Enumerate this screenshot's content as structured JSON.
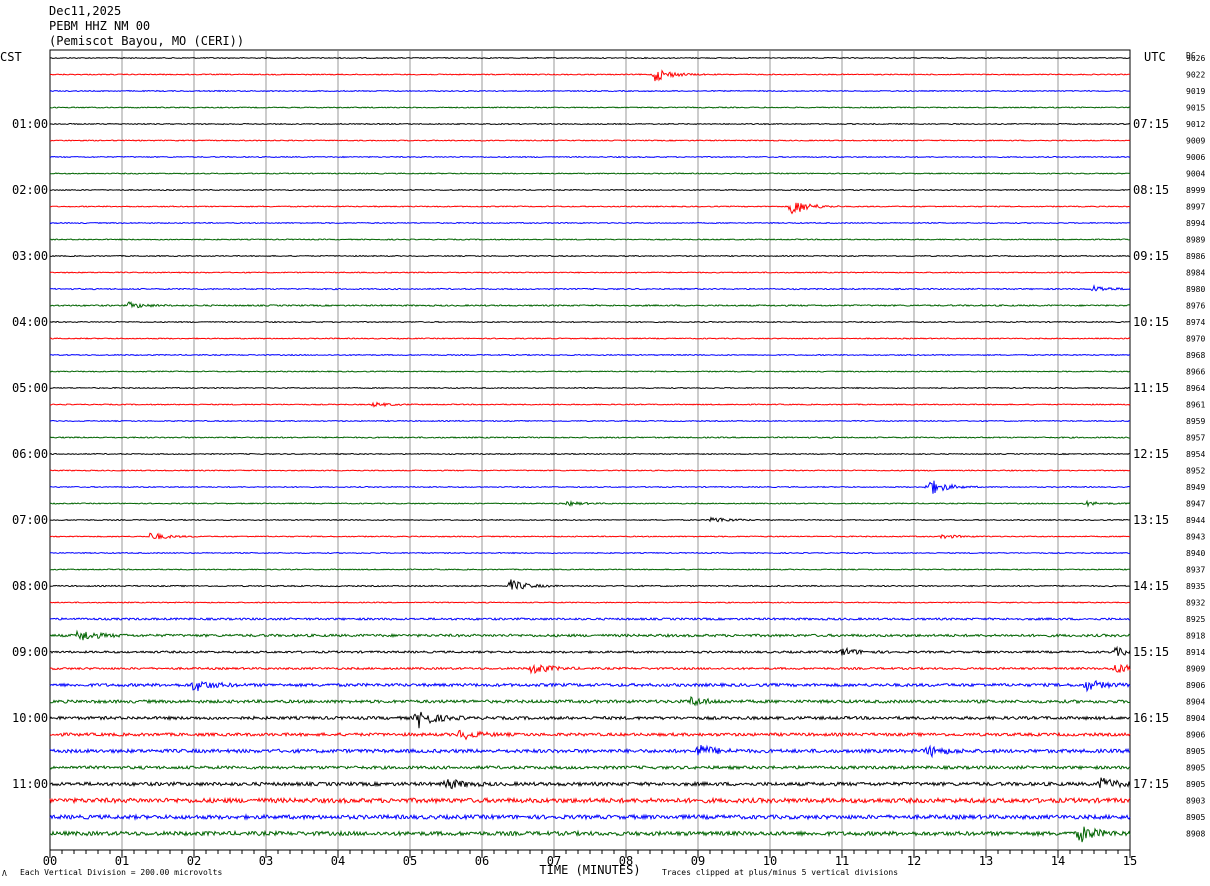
{
  "header": {
    "date": "Dec11,2025",
    "station": "PEBM HHZ NM 00",
    "location": "(Pemiscot Bayou, MO (CERI))"
  },
  "left_zone": "CST",
  "right_zone": "UTC",
  "dc_label": "DC",
  "colors": {
    "cycle": [
      "#000000",
      "#ff0000",
      "#0000ff",
      "#006400"
    ],
    "grid": "#808080"
  },
  "chart_data": {
    "type": "line",
    "xlabel": "TIME (MINUTES)",
    "xlim": [
      0,
      15
    ],
    "x_ticks": [
      "00",
      "01",
      "02",
      "03",
      "04",
      "05",
      "06",
      "07",
      "08",
      "09",
      "10",
      "11",
      "12",
      "13",
      "14",
      "15"
    ],
    "left_labels": [
      "01:00",
      "02:00",
      "03:00",
      "04:00",
      "05:00",
      "06:00",
      "07:00",
      "08:00",
      "09:00",
      "10:00",
      "11:00"
    ],
    "right_labels": [
      "07:15",
      "08:15",
      "09:15",
      "10:15",
      "11:15",
      "12:15",
      "13:15",
      "14:15",
      "15:15",
      "16:15",
      "17:15"
    ],
    "dc_offsets": [
      "9026",
      "9022",
      "9019",
      "9015",
      "9012",
      "9009",
      "9006",
      "9004",
      "8999",
      "8997",
      "8994",
      "8989",
      "8986",
      "8984",
      "8980",
      "8976",
      "8974",
      "8970",
      "8968",
      "8966",
      "8964",
      "8961",
      "8959",
      "8957",
      "8954",
      "8952",
      "8949",
      "8947",
      "8944",
      "8943",
      "8940",
      "8937",
      "8935",
      "8932",
      "8925",
      "8918",
      "8914",
      "8909",
      "8906",
      "8904",
      "8904",
      "8906",
      "8905",
      "8905",
      "8905",
      "8903",
      "8905",
      "8908"
    ],
    "trace_count": 48,
    "noise_levels": [
      1,
      1,
      1,
      1,
      1,
      1,
      1,
      1,
      1,
      1,
      1,
      1,
      1,
      1,
      1.2,
      1.4,
      1,
      1,
      1,
      1,
      1,
      1,
      1,
      1.2,
      1,
      1,
      1,
      1,
      1,
      1,
      1,
      1,
      1.2,
      1,
      2,
      2.5,
      2,
      2,
      3,
      3,
      3,
      3,
      3.5,
      3,
      3.5,
      4.5,
      4,
      4
    ],
    "events": [
      {
        "trace": 1,
        "minute": 8.4,
        "amp": 7
      },
      {
        "trace": 9,
        "minute": 10.3,
        "amp": 9
      },
      {
        "trace": 14,
        "minute": 14.5,
        "amp": 3
      },
      {
        "trace": 15,
        "minute": 1.1,
        "amp": 3
      },
      {
        "trace": 21,
        "minute": 4.5,
        "amp": 2
      },
      {
        "trace": 26,
        "minute": 12.2,
        "amp": 9
      },
      {
        "trace": 27,
        "minute": 7.2,
        "amp": 2
      },
      {
        "trace": 27,
        "minute": 14.4,
        "amp": 2
      },
      {
        "trace": 28,
        "minute": 9.2,
        "amp": 3
      },
      {
        "trace": 29,
        "minute": 1.4,
        "amp": 4
      },
      {
        "trace": 29,
        "minute": 12.4,
        "amp": 2
      },
      {
        "trace": 32,
        "minute": 6.4,
        "amp": 6
      },
      {
        "trace": 35,
        "minute": 0.4,
        "amp": 6
      },
      {
        "trace": 36,
        "minute": 11,
        "amp": 4
      },
      {
        "trace": 36,
        "minute": 14.8,
        "amp": 4
      },
      {
        "trace": 37,
        "minute": 6.7,
        "amp": 6
      },
      {
        "trace": 37,
        "minute": 14.8,
        "amp": 5
      },
      {
        "trace": 38,
        "minute": 2,
        "amp": 6
      },
      {
        "trace": 38,
        "minute": 14.4,
        "amp": 5
      },
      {
        "trace": 39,
        "minute": 8.9,
        "amp": 4
      },
      {
        "trace": 40,
        "minute": 5.1,
        "amp": 10
      },
      {
        "trace": 41,
        "minute": 5.7,
        "amp": 5
      },
      {
        "trace": 42,
        "minute": 9,
        "amp": 6
      },
      {
        "trace": 42,
        "minute": 12.2,
        "amp": 5
      },
      {
        "trace": 44,
        "minute": 5.5,
        "amp": 5
      },
      {
        "trace": 44,
        "minute": 14.6,
        "amp": 6
      },
      {
        "trace": 47,
        "minute": 14.3,
        "amp": 8
      }
    ]
  },
  "footer": {
    "vertical_division": "Each Vertical Division =  200.00 microvolts",
    "clipped": "Traces clipped at plus/minus 5 vertical divisions",
    "corner_mark": "Λ"
  }
}
